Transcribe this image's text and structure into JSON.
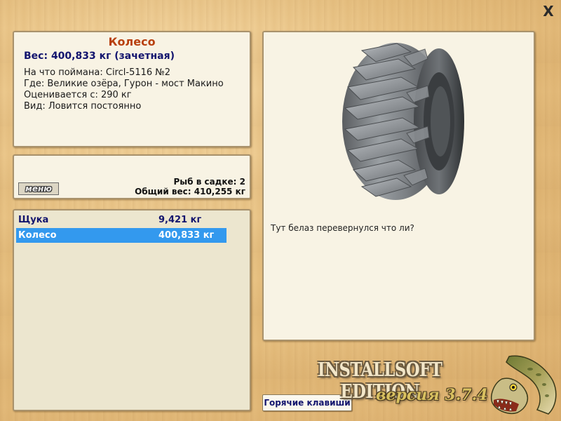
{
  "window": {
    "close_label": "X"
  },
  "fish": {
    "name": "Колесо",
    "weight_line": "Вес: 400,833 кг (зачетная)",
    "details": [
      "На что поймана: Circl-5116 №2",
      "Где: Великие озёра, Гурон - мост Макино",
      "Оценивается с: 290 кг",
      "Вид: Ловится постоянно"
    ],
    "image_icon": "tire-image",
    "comment": "Тут белаз перевернулся что ли?"
  },
  "keep_net": {
    "menu_label": "меню",
    "fish_count": "Рыб в садке: 2",
    "total_weight": "Общий вес: 410,255 кг"
  },
  "catch_list": [
    {
      "name": "Щука",
      "weight": "9,421 кг",
      "selected": false
    },
    {
      "name": "Колесо",
      "weight": "400,833 кг",
      "selected": true
    }
  ],
  "footer": {
    "hotkeys_label": "Горячие клавиши",
    "edition": "INSTALLSOFT EDITION",
    "version": "версия 3.7.4",
    "logo_icon": "pike-fish-icon"
  },
  "colors": {
    "title": "#b8400f",
    "accent_text": "#12146e",
    "selection": "#3399ee",
    "panel_bg": "#f8f3e4"
  }
}
